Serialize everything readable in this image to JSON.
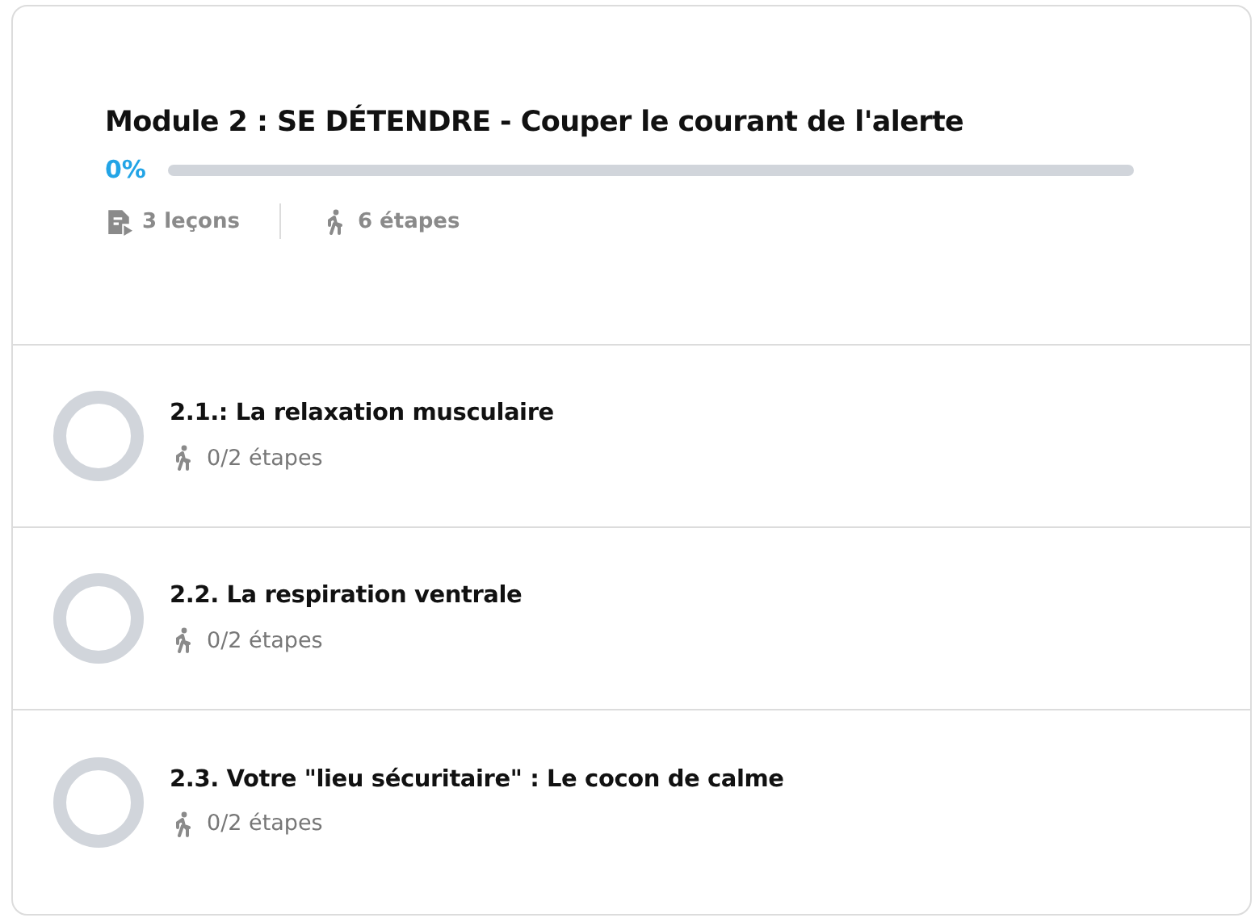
{
  "module": {
    "title": "Module 2 : SE DÉTENDRE - Couper le courant de l'alerte",
    "percent": "0%",
    "level": 0,
    "lessons_count": "3 leçons",
    "steps_count": "6 étapes"
  },
  "lessons": [
    {
      "title": "2.1.: La relaxation musculaire",
      "steps": "0/2 étapes",
      "level": 0
    },
    {
      "title": "2.2. La respiration ventrale",
      "steps": "0/2 étapes",
      "level": 0
    },
    {
      "title": "2.3. Votre \"lieu sécuritaire\" : Le cocon de calme",
      "steps": "0/2 étapes",
      "level": 0
    }
  ]
}
